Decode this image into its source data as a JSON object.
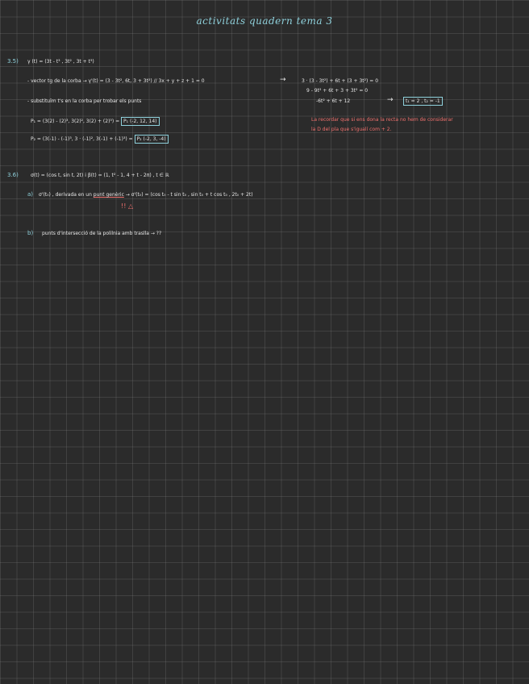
{
  "header": {
    "title": "activitats quadern tema 3"
  },
  "ex35": {
    "number": "3.5)",
    "def": "γ (t) = (3t - t³ , 3t² , 3t + t³)",
    "line1": "- vector tg de la corba → γ'(t) = (3 - 3t², 6t, 3 + 3t²) // 3x + y + z + 1 = 0",
    "arrow1": "→",
    "sys1": "3 · (3 - 3t²) + 6t + (3 + 3t²) = 0",
    "sys2": "9 - 9t² + 6t + 3 + 3t² = 0",
    "sys3": "-6t² + 6t + 12",
    "arrow2": "→",
    "result": "t₁ = 2 , t₂ = -1",
    "line2": "- substituïm t's en la corba per trobar els punts",
    "p1": "P₁ = (3(2) - (2)³, 3(2)², 3(2) + (2)³) = ",
    "p1_box": "P₁ (-2, 12, 14)",
    "p2": "P₂ = (3(-1) - (-1)³, 3 · (-1)², 3(-1) + (-1)³) = ",
    "p2_box": "P₂ (-2, 3, -4)",
    "note1": "La recordar que si ens dona la recta no hem de considerar",
    "note2": "la D del pla que s'igualí com + 2."
  },
  "ex36": {
    "number": "3.6)",
    "def": "σ(t) = (cos t, sin t, 2t)  i  β(t) = (1, t² - 1, 4 + t - 2π)  ,  t ∈ ℝ",
    "a_label": "a)",
    "a_text_1": "σ'(t₀) , derivada en un ",
    "a_text_u": "punt genèric",
    "a_text_2": " → σ'(t₀) = (cos t₀ - t sin t₀ , sin t₀ + t cos t₀ , 2t₀ + 2t)",
    "a_note": "!! △",
    "b_label": "b)",
    "b_text": "punts d'intersecció de la  polilnia amb traslla → ??"
  }
}
